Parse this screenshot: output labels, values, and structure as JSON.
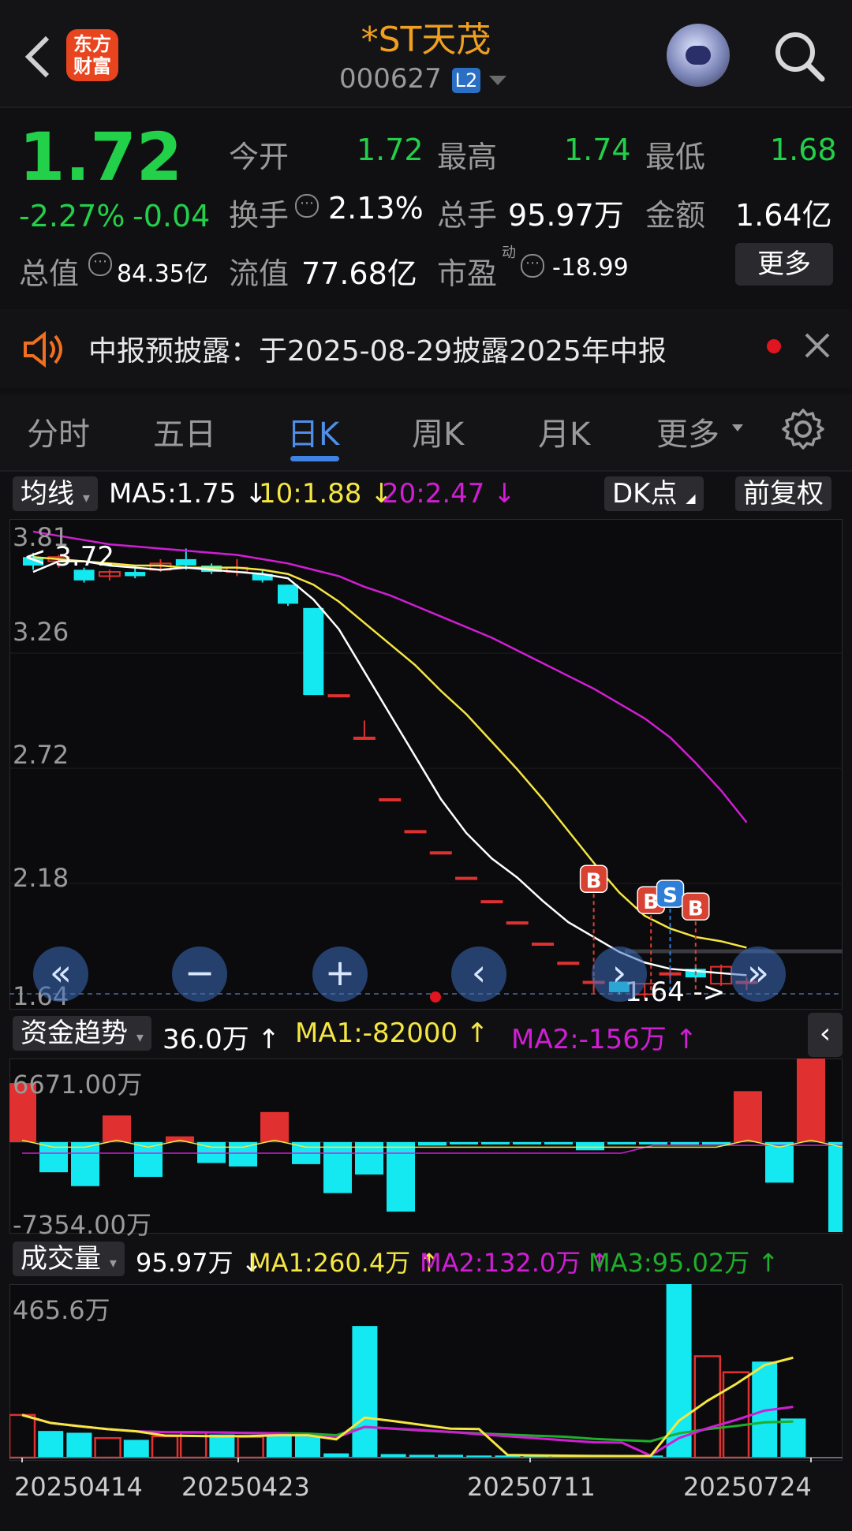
{
  "header": {
    "logo_text": "东方财富",
    "title": "*ST天茂",
    "code": "000627",
    "level_badge": "L2",
    "icons": [
      "back-arrow-icon",
      "robot-avatar-icon",
      "search-icon"
    ]
  },
  "quote": {
    "price": "1.72",
    "change_pct": "-2.27%",
    "change_abs": "-0.04",
    "stats": [
      {
        "label": "今开",
        "value": "1.72"
      },
      {
        "label": "最高",
        "value": "1.74"
      },
      {
        "label": "最低",
        "value": "1.68"
      },
      {
        "label": "换手",
        "value": "2.13%"
      },
      {
        "label": "总手",
        "value": "95.97万"
      },
      {
        "label": "金额",
        "value": "1.64亿"
      },
      {
        "label": "总值",
        "value": "84.35亿"
      },
      {
        "label": "流值",
        "value": "77.68亿"
      },
      {
        "label": "市盈",
        "value": "-18.99"
      }
    ],
    "pe_superscript": "动",
    "more_label": "更多"
  },
  "notice": {
    "text": "中报预披露：于2025-08-29披露2025年中报"
  },
  "tabs": [
    {
      "label": "分时",
      "active": false
    },
    {
      "label": "五日",
      "active": false
    },
    {
      "label": "日K",
      "active": true
    },
    {
      "label": "周K",
      "active": false
    },
    {
      "label": "月K",
      "active": false
    },
    {
      "label": "更多",
      "active": false
    }
  ],
  "kline": {
    "indicator_label": "均线",
    "ma5": "MA5:1.75",
    "ma10": "10:1.88",
    "ma20": "20:2.47",
    "dk_label": "DK点",
    "adjust_label": "前复权",
    "y_ticks": [
      "3.81",
      "3.26",
      "2.72",
      "2.18",
      "1.64"
    ],
    "high_marker": "3.72",
    "low_marker": "1.64",
    "signals": [
      "B",
      "B",
      "S",
      "B"
    ]
  },
  "fund": {
    "indicator_label": "资金趋势",
    "value": "36.0万",
    "ma1": "MA1:-82000",
    "ma2": "MA2:-156万",
    "y_top": "6671.00万",
    "y_bottom": "-7354.00万"
  },
  "volume": {
    "indicator_label": "成交量",
    "value": "95.97万",
    "ma1": "MA1:260.4万",
    "ma2": "MA2:132.0万",
    "ma3": "MA3:95.02万",
    "y_top": "465.6万",
    "dates": [
      "20250414",
      "20250423",
      "20250711",
      "20250724"
    ]
  },
  "colors": {
    "up": "#e03030",
    "down": "#14e8f0",
    "ma5": "#ffffff",
    "ma10": "#f5e642",
    "ma20": "#d01ed4",
    "green": "#22d04a",
    "accent": "#f0a020"
  },
  "chart_data": [
    {
      "type": "candlestick",
      "ylim": [
        1.64,
        3.81
      ],
      "open": [
        3.72,
        3.7,
        3.66,
        3.63,
        3.65,
        3.66,
        3.71,
        3.68,
        3.65,
        3.64,
        3.59,
        3.48,
        3.07,
        2.87,
        2.58,
        2.43,
        2.33,
        2.21,
        2.1,
        2.0,
        1.9,
        1.81,
        1.72,
        1.72,
        1.66,
        1.76,
        1.78,
        1.71,
        1.72
      ],
      "close": [
        3.68,
        3.72,
        3.61,
        3.65,
        3.63,
        3.69,
        3.68,
        3.65,
        3.67,
        3.61,
        3.5,
        3.07,
        3.07,
        2.87,
        2.58,
        2.43,
        2.33,
        2.21,
        2.1,
        2.0,
        1.9,
        1.81,
        1.72,
        1.67,
        1.71,
        1.76,
        1.74,
        1.79,
        1.72
      ],
      "high": [
        3.74,
        3.73,
        3.67,
        3.66,
        3.68,
        3.71,
        3.76,
        3.69,
        3.71,
        3.66,
        3.59,
        3.48,
        3.07,
        2.95,
        2.58,
        2.43,
        2.33,
        2.21,
        2.1,
        2.0,
        1.9,
        1.81,
        1.74,
        1.72,
        1.71,
        1.79,
        1.8,
        1.8,
        1.74
      ],
      "low": [
        3.66,
        3.67,
        3.6,
        3.61,
        3.62,
        3.65,
        3.66,
        3.64,
        3.63,
        3.6,
        3.49,
        3.07,
        3.07,
        2.87,
        2.58,
        2.43,
        2.33,
        2.21,
        2.1,
        2.0,
        1.9,
        1.81,
        1.66,
        1.66,
        1.64,
        1.73,
        1.72,
        1.7,
        1.68
      ],
      "ma5": [
        3.65,
        3.7,
        3.7,
        3.68,
        3.67,
        3.66,
        3.67,
        3.66,
        3.65,
        3.64,
        3.62,
        3.52,
        3.38,
        3.18,
        2.98,
        2.78,
        2.58,
        2.42,
        2.3,
        2.21,
        2.1,
        2.0,
        1.93,
        1.86,
        1.81,
        1.78,
        1.77,
        1.76,
        1.75
      ],
      "ma10": [
        3.72,
        3.71,
        3.7,
        3.69,
        3.68,
        3.68,
        3.67,
        3.67,
        3.67,
        3.66,
        3.64,
        3.59,
        3.51,
        3.41,
        3.31,
        3.21,
        3.09,
        2.98,
        2.85,
        2.72,
        2.58,
        2.43,
        2.28,
        2.14,
        2.03,
        1.97,
        1.93,
        1.91,
        1.88
      ],
      "ma20": [
        3.84,
        3.82,
        3.8,
        3.78,
        3.77,
        3.76,
        3.75,
        3.74,
        3.73,
        3.71,
        3.69,
        3.66,
        3.63,
        3.58,
        3.54,
        3.49,
        3.44,
        3.39,
        3.34,
        3.28,
        3.22,
        3.16,
        3.1,
        3.03,
        2.96,
        2.87,
        2.75,
        2.62,
        2.47
      ]
    },
    {
      "type": "bar",
      "title": "资金趋势",
      "values": [
        5100,
        -2600,
        -3800,
        2300,
        -3000,
        500,
        -1800,
        -2100,
        2600,
        -1900,
        -4400,
        -2800,
        -6000,
        -300,
        -200,
        -200,
        -200,
        -200,
        -700,
        -200,
        -200,
        -200,
        -200,
        4400,
        -3500,
        9500,
        -10500,
        300
      ],
      "ylim": [
        -7354,
        6671
      ]
    },
    {
      "type": "bar",
      "title": "成交量",
      "values": [
        120,
        75,
        70,
        55,
        50,
        60,
        70,
        65,
        58,
        62,
        60,
        12,
        370,
        10,
        8,
        8,
        6,
        6,
        4,
        4,
        4,
        4,
        6,
        500,
        285,
        240,
        270,
        110
      ],
      "ylim": [
        0,
        465.6
      ]
    }
  ]
}
